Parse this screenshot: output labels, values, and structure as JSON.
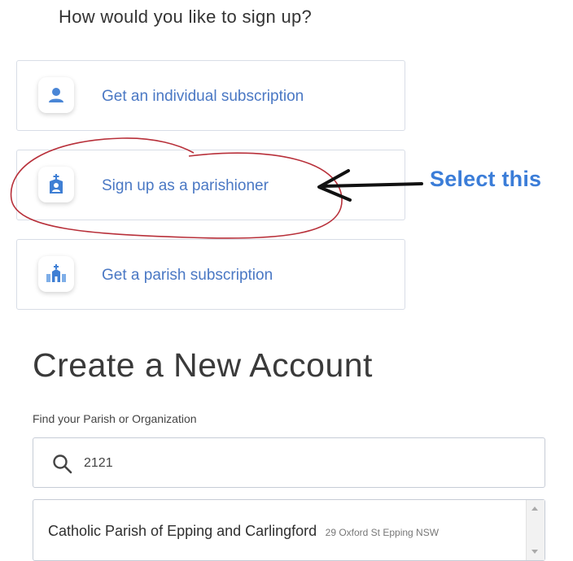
{
  "signup": {
    "title": "How would you like to sign up?",
    "options": [
      {
        "label": "Get an individual subscription",
        "icon": "person-icon"
      },
      {
        "label": "Sign up as a parishioner",
        "icon": "church-person-icon"
      },
      {
        "label": "Get a parish subscription",
        "icon": "parish-icon"
      }
    ]
  },
  "annotation": {
    "callout_text": "Select this",
    "callout_color": "#3b7dd8",
    "circle_color": "#b8303a"
  },
  "account": {
    "heading": "Create a New Account",
    "find_label": "Find your Parish or Organization",
    "search_value": "2121",
    "search_icon": "search-icon",
    "results": [
      {
        "name": "Catholic Parish of Epping and Carlingford",
        "address": "29 Oxford St Epping NSW"
      }
    ]
  },
  "colors": {
    "accent": "#4a78c4",
    "border": "#d8dde6"
  }
}
